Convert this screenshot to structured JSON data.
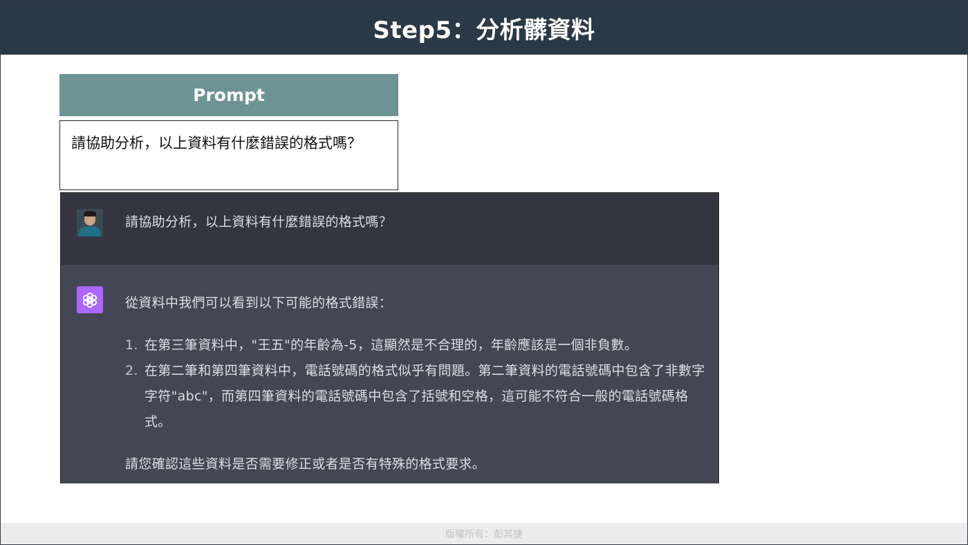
{
  "header": {
    "title": "Step5：分析髒資料"
  },
  "prompt": {
    "label": "Prompt",
    "text": "請協助分析，以上資料有什麼錯誤的格式嗎？"
  },
  "chat": {
    "user_message": "請協助分析，以上資料有什麼錯誤的格式嗎？",
    "assistant": {
      "intro": "從資料中我們可以看到以下可能的格式錯誤：",
      "items": [
        {
          "number": "1.",
          "text": "在第三筆資料中，\"王五\"的年齡為-5，這顯然是不合理的，年齡應該是一個非負數。"
        },
        {
          "number": "2.",
          "text": "在第二筆和第四筆資料中，電話號碼的格式似乎有問題。第二筆資料的電話號碼中包含了非數字字符\"abc\"，而第四筆資料的電話號碼中包含了括號和空格，這可能不符合一般的電話號碼格式。"
        }
      ],
      "closing": "請您確認這些資料是否需要修正或者是否有特殊的格式要求。"
    }
  },
  "footer": {
    "copyright": "版權所有：彭其捷"
  },
  "icons": {
    "user_avatar": "user-avatar-photo",
    "assistant_avatar": "chatgpt-logo-icon"
  },
  "colors": {
    "header_bg": "#2a3945",
    "prompt_label_bg": "#6e9394",
    "user_row_bg": "#343541",
    "assistant_row_bg": "#444654",
    "assistant_icon_bg": "#ab68ff"
  }
}
